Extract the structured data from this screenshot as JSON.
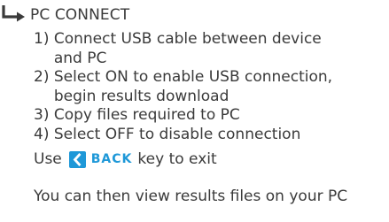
{
  "heading": "PC CONNECT",
  "steps": [
    {
      "num": "1)",
      "text": "Connect USB cable between device and PC"
    },
    {
      "num": "2)",
      "text": "Select ON to enable USB connection, begin results download"
    },
    {
      "num": "3)",
      "text": "Copy files required to PC"
    },
    {
      "num": "4)",
      "text": "Select OFF to disable connection"
    }
  ],
  "exit": {
    "prefix": "Use",
    "key_label": "BACK",
    "suffix": "key to exit"
  },
  "footer": "You can then view results files on your PC",
  "colors": {
    "accent": "#1e98d8",
    "text": "#3a3a3a"
  },
  "icons": {
    "heading_icon": "return-arrow-icon",
    "back_icon": "chevron-left-icon"
  }
}
